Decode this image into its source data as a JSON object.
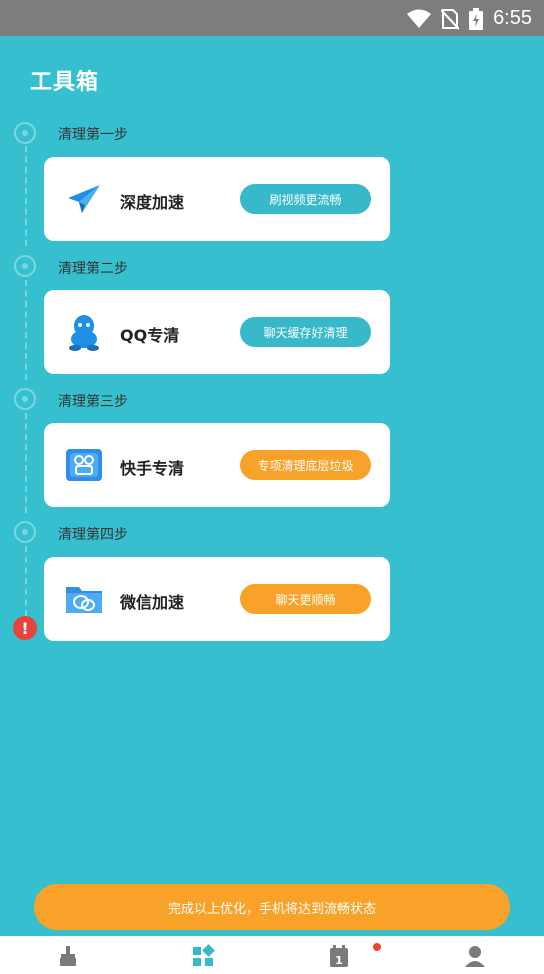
{
  "status_bar": {
    "time": "6:55",
    "icons": [
      "wifi-icon",
      "no-sim-icon",
      "battery-charging-icon"
    ]
  },
  "page": {
    "title": "工具箱"
  },
  "steps": [
    {
      "label": "清理第一步",
      "card_title": "深度加速",
      "button": "刷视频更流畅",
      "button_color": "#37b9c9",
      "icon": "paper-plane-icon"
    },
    {
      "label": "清理第二步",
      "card_title": "QQ专清",
      "button": "聊天缓存好清理",
      "button_color": "#37b9c9",
      "icon": "qq-penguin-icon"
    },
    {
      "label": "清理第三步",
      "card_title": "快手专清",
      "button": "专项清理底层垃圾",
      "button_color": "#f9a22a",
      "icon": "kuaishou-icon"
    },
    {
      "label": "清理第四步",
      "card_title": "微信加速",
      "button": "聊天更顺畅",
      "button_color": "#f9a22a",
      "icon": "wechat-folder-icon"
    }
  ],
  "alert": {
    "text": "!"
  },
  "bottom_button": "完成以上优化，手机将达到流畅状态",
  "nav": [
    {
      "icon": "broom-icon",
      "active": false
    },
    {
      "icon": "toolbox-icon",
      "active": true
    },
    {
      "icon": "calendar-icon",
      "active": false,
      "badge": true,
      "calendar_day": "1"
    },
    {
      "icon": "profile-icon",
      "active": false
    }
  ],
  "colors": {
    "background": "#36c0cf",
    "teal": "#37b9c9",
    "orange": "#f9a22a",
    "alert": "#e8433c"
  }
}
